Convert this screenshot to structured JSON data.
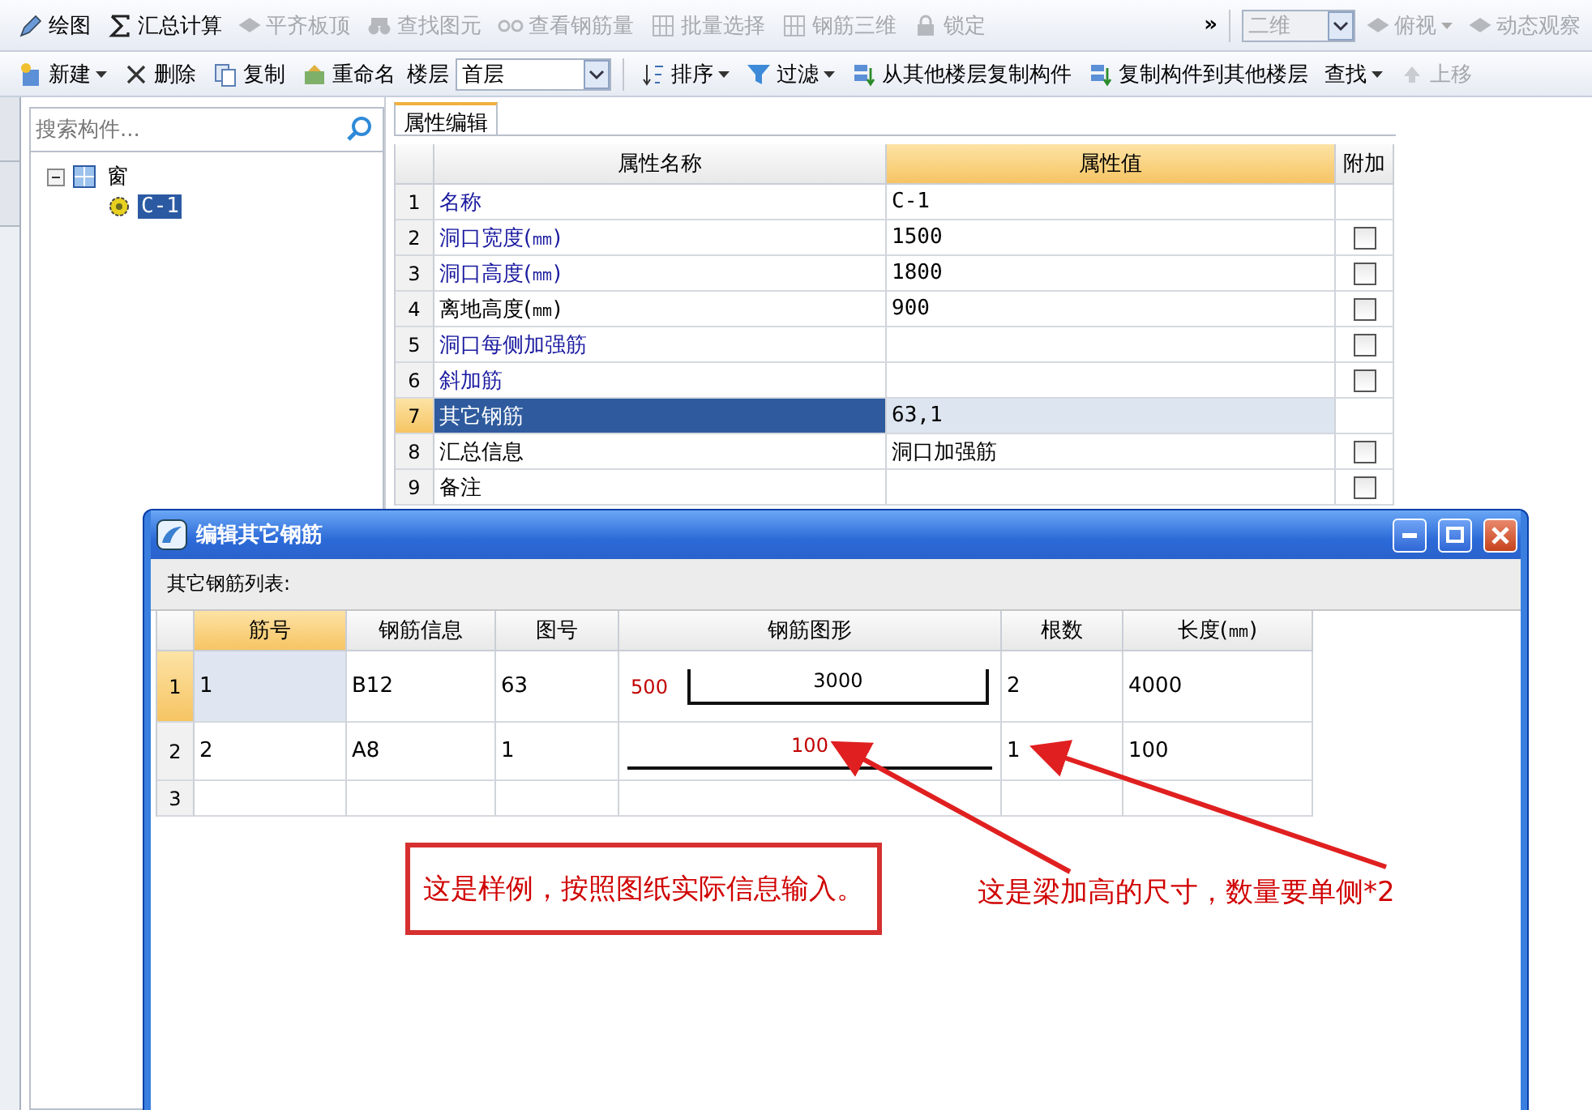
{
  "toolbar_top": [
    {
      "label": "绘图",
      "disabled": false
    },
    {
      "label": "汇总计算",
      "disabled": false
    },
    {
      "label": "平齐板顶",
      "disabled": true
    },
    {
      "label": "查找图元",
      "disabled": true
    },
    {
      "label": "查看钢筋量",
      "disabled": true
    },
    {
      "label": "批量选择",
      "disabled": true
    },
    {
      "label": "钢筋三维",
      "disabled": true
    },
    {
      "label": "锁定",
      "disabled": true
    }
  ],
  "toolbar_top_overflow": "»",
  "view_tools": [
    {
      "label": "二维",
      "kind": "select",
      "disabled": true
    },
    {
      "label": "俯视",
      "kind": "button",
      "disabled": true
    },
    {
      "label": "动态观察",
      "kind": "button",
      "disabled": true
    }
  ],
  "toolbar_edit": [
    {
      "label": "新建",
      "dropdown": true,
      "disabled": false
    },
    {
      "label": "删除",
      "dropdown": false,
      "disabled": false
    },
    {
      "label": "复制",
      "dropdown": false,
      "disabled": false
    },
    {
      "label": "重命名",
      "dropdown": false,
      "disabled": false
    },
    {
      "kind": "floor",
      "label": "楼层",
      "value": "首层"
    },
    {
      "label": "排序",
      "dropdown": true,
      "disabled": false
    },
    {
      "label": "过滤",
      "dropdown": true,
      "disabled": false
    },
    {
      "label": "从其他楼层复制构件",
      "dropdown": false,
      "disabled": false
    },
    {
      "label": "复制构件到其他楼层",
      "dropdown": false,
      "disabled": false
    },
    {
      "label": "查找",
      "dropdown": true,
      "disabled": false
    },
    {
      "label": "上移",
      "dropdown": false,
      "disabled": true
    }
  ],
  "tree": {
    "search_placeholder": "搜索构件...",
    "items": [
      {
        "label": "窗",
        "expanded": true,
        "selected": false,
        "children": [
          {
            "label": "C-1",
            "selected": true
          }
        ]
      }
    ]
  },
  "properties": {
    "tab": "属性编辑",
    "columns": [
      "属性名称",
      "属性值",
      "附加"
    ],
    "rows": [
      {
        "index": "1",
        "name": "名称",
        "value": "C-1",
        "color": "#1a1aa0",
        "selected": false
      },
      {
        "index": "2",
        "name": "洞口宽度(㎜)",
        "value": "1500",
        "color": "#1a1aa0",
        "selected": false,
        "checked": false
      },
      {
        "index": "3",
        "name": "洞口高度(㎜)",
        "value": "1800",
        "color": "#1a1aa0",
        "selected": false,
        "checked": false
      },
      {
        "index": "4",
        "name": "离地高度(㎜)",
        "value": "900",
        "color": "#000000",
        "selected": false,
        "checked": false
      },
      {
        "index": "5",
        "name": "洞口每侧加强筋",
        "value": "",
        "color": "#1a1aa0",
        "selected": false,
        "checked": false
      },
      {
        "index": "6",
        "name": "斜加筋",
        "value": "",
        "color": "#1a1aa0",
        "selected": false,
        "checked": false
      },
      {
        "index": "7",
        "name": "其它钢筋",
        "value": "63,1",
        "selected": true
      },
      {
        "index": "8",
        "name": "汇总信息",
        "value": "洞口加强筋",
        "color": "#000000",
        "selected": false,
        "checked": false
      },
      {
        "index": "9",
        "name": "备注",
        "value": "",
        "color": "#000000",
        "selected": false,
        "checked": false
      }
    ]
  },
  "dialog": {
    "title": "编辑其它钢筋",
    "list_label": "其它钢筋列表:",
    "columns": [
      "筋号",
      "钢筋信息",
      "图号",
      "钢筋图形",
      "根数",
      "长度(㎜)"
    ],
    "rows": [
      {
        "index": "1",
        "selected": true,
        "bar_no": "1",
        "info": "B12",
        "figure_no": "63",
        "shape": {
          "kind": "hook",
          "side": "500",
          "main": "3000"
        },
        "count": "2",
        "length": "4000"
      },
      {
        "index": "2",
        "selected": false,
        "bar_no": "2",
        "info": "A8",
        "figure_no": "1",
        "shape": {
          "kind": "straight",
          "main": "100"
        },
        "count": "1",
        "length": "100"
      },
      {
        "index": "3",
        "selected": false
      }
    ]
  },
  "annotations": [
    {
      "kind": "boxed",
      "text": "这是样例，按照图纸实际信息输入。"
    },
    {
      "kind": "plain",
      "text": "这是梁加高的尺寸，数量要单侧*2"
    }
  ]
}
